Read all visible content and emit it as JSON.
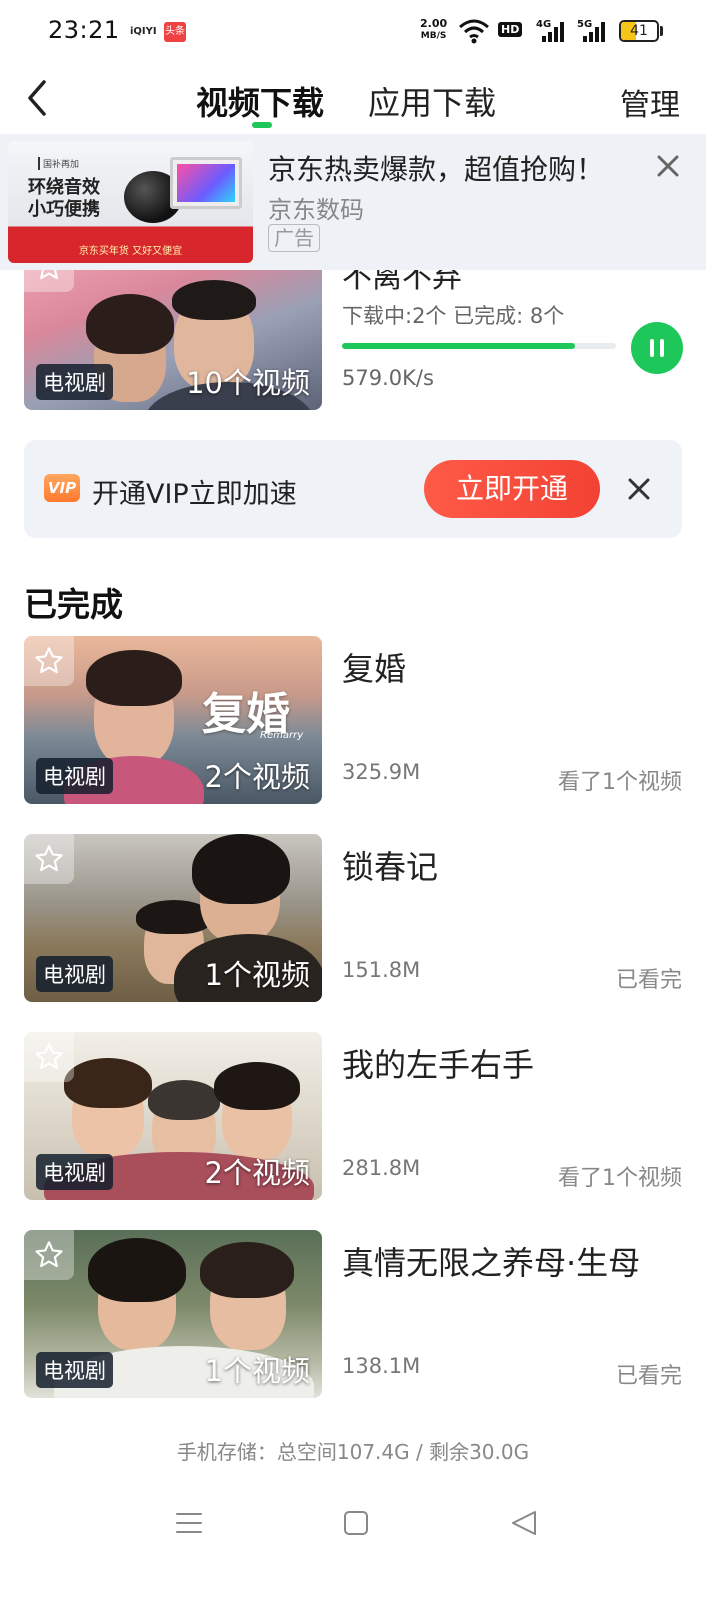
{
  "status_bar": {
    "time": "23:21",
    "app_icon_1": "iQIYI",
    "app_icon_2": "头条",
    "net_speed_value": "2.00",
    "net_speed_unit": "MB/S",
    "hd_label": "HD",
    "battery": "41"
  },
  "header": {
    "tab_video": "视频下载",
    "tab_app": "应用下载",
    "manage": "管理",
    "accent_color": "#1ec75a"
  },
  "ad": {
    "img_tag": "国补再加",
    "img_line1": "环绕音效",
    "img_line2": "小巧便携",
    "img_bottom": "京东买年货 又好又便宜",
    "title": "京东热卖爆款，超值抢购！",
    "subtitle": "京东数码",
    "badge": "广告"
  },
  "downloading": {
    "title": "不离不弃",
    "tag": "电视剧",
    "count": "10个视频",
    "status": "下载中:2个 已完成: 8个",
    "progress": 0.85,
    "speed": "579.0K/s"
  },
  "vip": {
    "icon": "VIP",
    "text": "开通VIP立即加速",
    "button": "立即开通"
  },
  "completed_section": "已完成",
  "completed": [
    {
      "title": "复婚",
      "tag": "电视剧",
      "count": "2个视频",
      "size": "325.9M",
      "status": "看了1个视频",
      "poster_text": "复婚",
      "poster_sub": "Remarry"
    },
    {
      "title": "锁春记",
      "tag": "电视剧",
      "count": "1个视频",
      "size": "151.8M",
      "status": "已看完"
    },
    {
      "title": "我的左手右手",
      "tag": "电视剧",
      "count": "2个视频",
      "size": "281.8M",
      "status": "看了1个视频"
    },
    {
      "title": "真情无限之养母·生母",
      "tag": "电视剧",
      "count": "1个视频",
      "size": "138.1M",
      "status": "已看完"
    }
  ],
  "storage": "手机存储：总空间107.4G / 剩余30.0G"
}
